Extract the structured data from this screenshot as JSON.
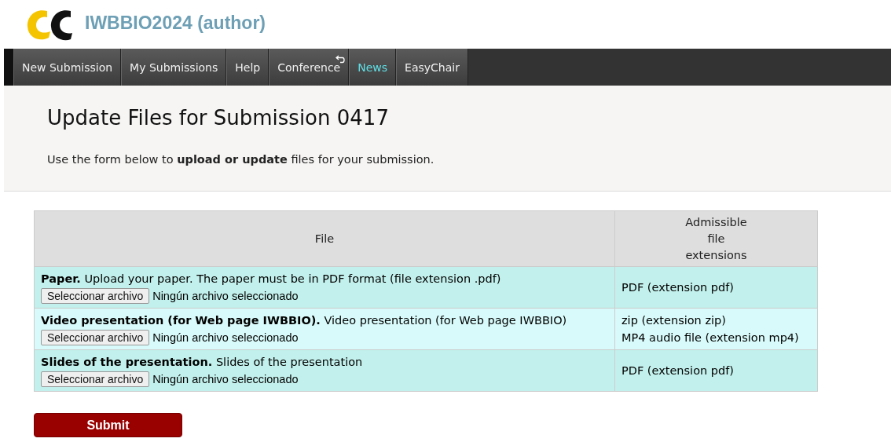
{
  "header": {
    "title": "IWBBIO2024 (author)"
  },
  "menu": [
    {
      "label": "New Submission",
      "selected": false,
      "kind": "plain"
    },
    {
      "label": "My Submissions",
      "selected": false,
      "kind": "plain"
    },
    {
      "label": "Help",
      "selected": false,
      "kind": "plain"
    },
    {
      "label": "Conference",
      "selected": false,
      "kind": "return"
    },
    {
      "label": "News",
      "selected": true,
      "kind": "plain"
    },
    {
      "label": "EasyChair",
      "selected": false,
      "kind": "plain"
    }
  ],
  "page": {
    "title": "Update Files for Submission 0417",
    "intro": "Use the form below to **upload or update** files for your submission."
  },
  "table": {
    "columns": [
      "File",
      "Admissible file extensions"
    ],
    "rows": [
      {
        "name": "Paper.",
        "description": "Upload your paper. The paper must be in PDF format (file extension .pdf)",
        "button": "Seleccionar archivo",
        "status": "Ningún archivo seleccionado",
        "extensions": [
          "PDF (extension pdf)"
        ]
      },
      {
        "name": "Video presentation (for Web page IWBBIO).",
        "description": "Video presentation (for Web page IWBBIO)",
        "button": "Seleccionar archivo",
        "status": "Ningún archivo seleccionado",
        "extensions": [
          "zip (extension zip)",
          "MP4 audio file (extension mp4)"
        ]
      },
      {
        "name": "Slides of the presentation.",
        "description": "Slides of the presentation",
        "button": "Seleccionar archivo",
        "status": "Ningún archivo seleccionado",
        "extensions": [
          "PDF (extension pdf)"
        ]
      }
    ]
  },
  "submit": "Submit"
}
